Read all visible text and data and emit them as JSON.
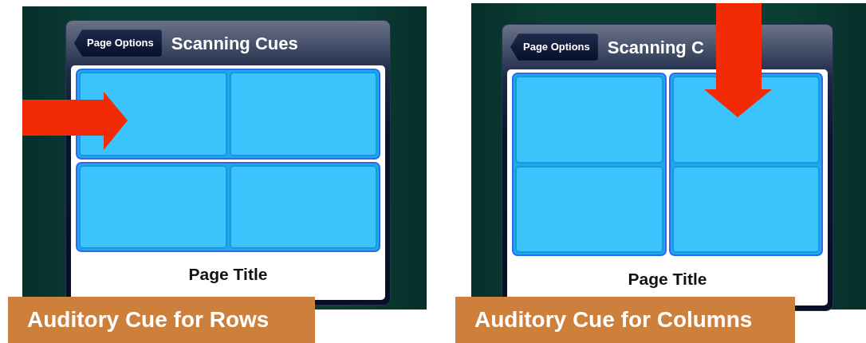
{
  "panels": [
    {
      "screen": {
        "back_button": "Page Options",
        "title": "Scanning Cues",
        "page_title": "Page Title",
        "grid": {
          "kind": "rows"
        }
      },
      "arrow": {
        "kind": "right"
      },
      "caption": "Auditory Cue for Rows"
    },
    {
      "screen": {
        "back_button": "Page Options",
        "title": "Scanning C",
        "page_title": "Page Title",
        "grid": {
          "kind": "columns"
        }
      },
      "arrow": {
        "kind": "down"
      },
      "caption": "Auditory Cue for Columns"
    }
  ]
}
